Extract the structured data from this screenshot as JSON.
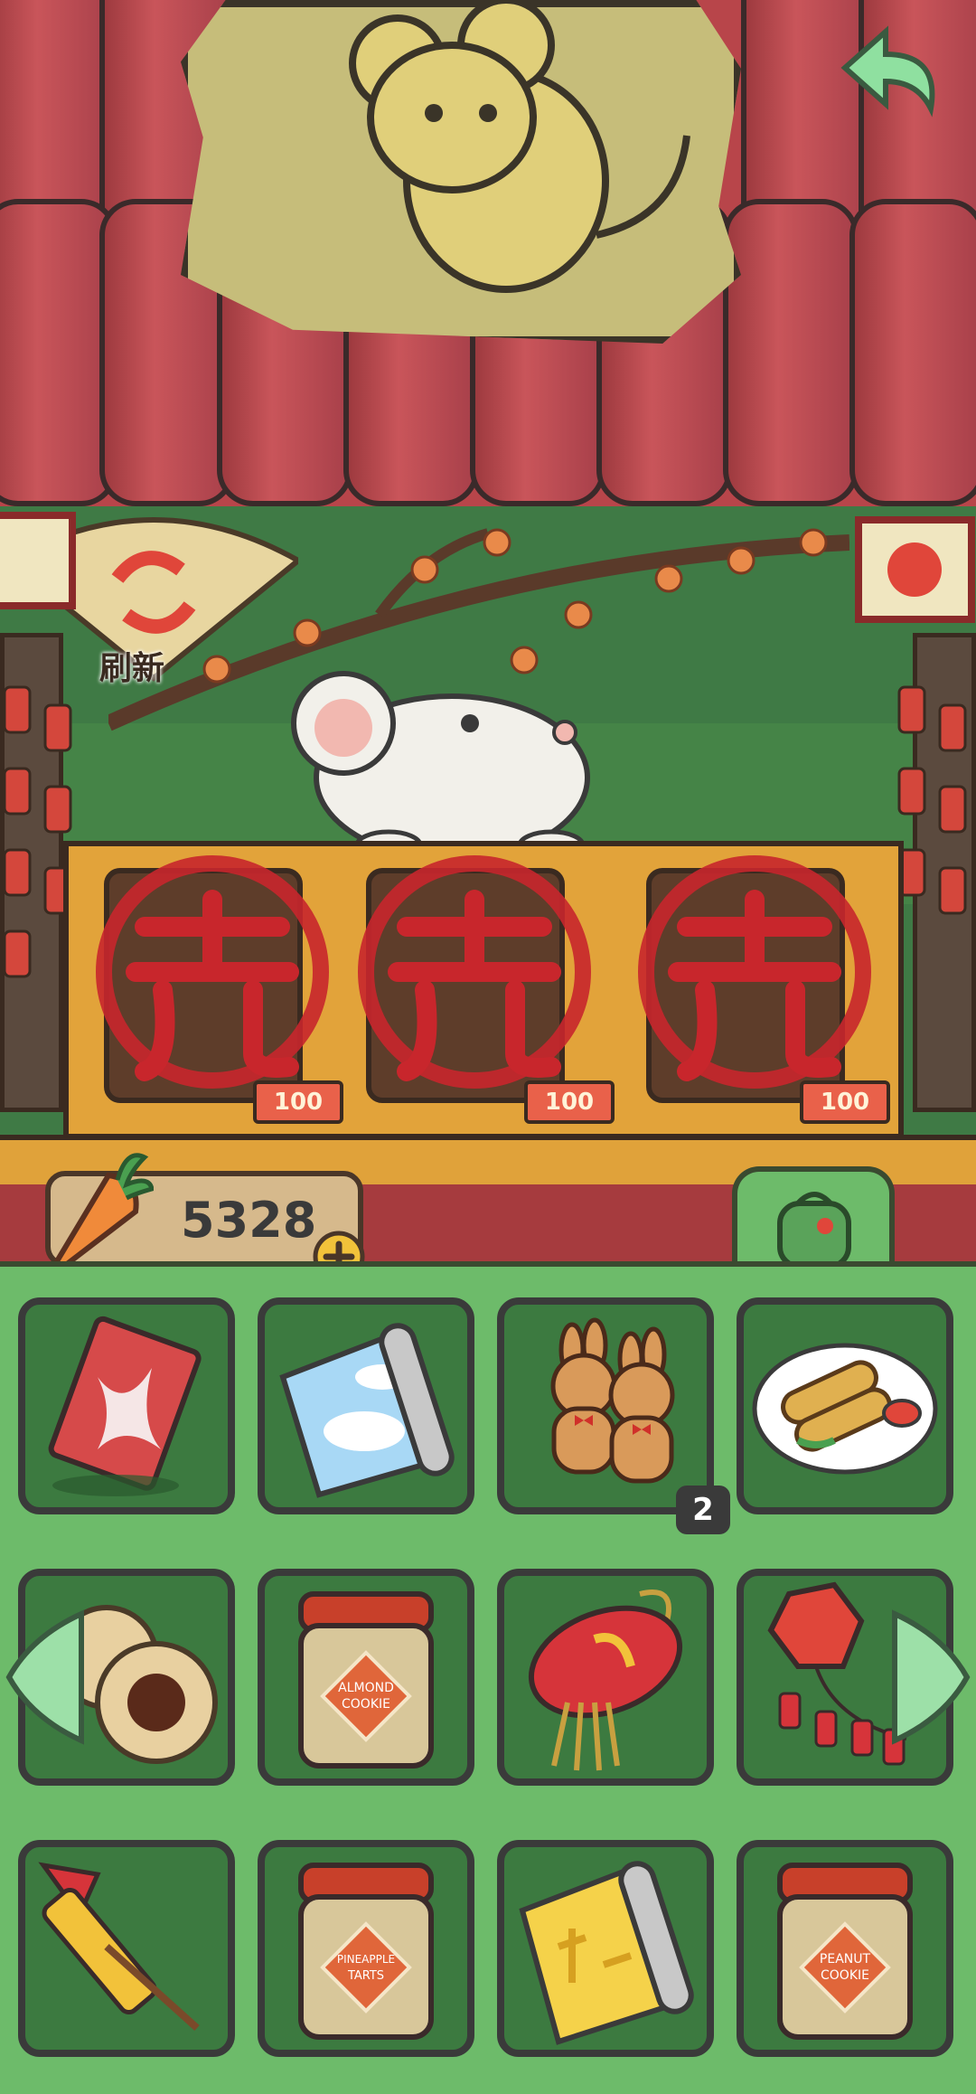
{
  "refresh": {
    "label": "刷新"
  },
  "shop": {
    "slots": [
      {
        "price": "100",
        "status": "sold"
      },
      {
        "price": "100",
        "status": "sold"
      },
      {
        "price": "100",
        "status": "sold"
      }
    ]
  },
  "currency": {
    "amount": "5328"
  },
  "inventory": {
    "items": [
      {
        "name": "red envelope kite",
        "icon": "kite-icon"
      },
      {
        "name": "sky scroll",
        "icon": "sky-scroll-icon"
      },
      {
        "name": "rabbit gingerbread cookies",
        "icon": "rabbit-cookies-icon",
        "count": "2"
      },
      {
        "name": "spring rolls",
        "icon": "spring-rolls-icon"
      },
      {
        "name": "sesame balls",
        "icon": "sesame-balls-icon"
      },
      {
        "name": "almond cookie jar",
        "icon": "almond-cookie-jar-icon",
        "jar_label": "ALMOND COOKIE"
      },
      {
        "name": "red lantern",
        "icon": "red-lantern-icon"
      },
      {
        "name": "firecracker string",
        "icon": "firecracker-icon"
      },
      {
        "name": "rocket firework",
        "icon": "rocket-firework-icon"
      },
      {
        "name": "pineapple tarts jar",
        "icon": "pineapple-tarts-jar-icon",
        "jar_label": "PINEAPPLE TARTS"
      },
      {
        "name": "fu scroll",
        "icon": "fu-scroll-icon"
      },
      {
        "name": "peanut cookie jar",
        "icon": "peanut-cookie-jar-icon",
        "jar_label": "PEANUT COOKIE"
      }
    ]
  },
  "colors": {
    "roof": "#b8454a",
    "panel": "#6dbb6a",
    "cell": "#3c7a40",
    "counter": "#e2a33a",
    "sold_stamp": "#c8262c"
  }
}
